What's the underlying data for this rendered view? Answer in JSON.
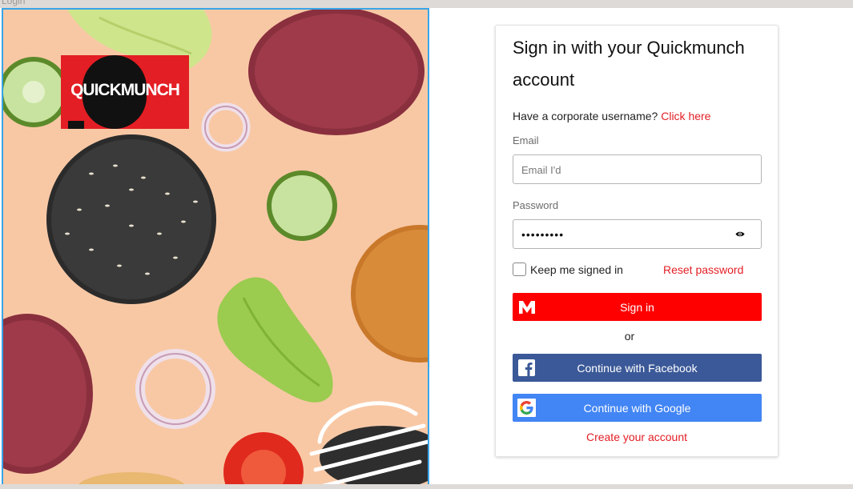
{
  "window": {
    "title": "Login"
  },
  "brand": {
    "logo_text": "QUICKMUNCH",
    "color": "#e31e24"
  },
  "login": {
    "title": "Sign in with your Quickmunch account",
    "corporate_prompt": "Have a corporate username?",
    "corporate_link": "Click here",
    "email_label": "Email",
    "email_placeholder": "Email I'd",
    "email_value": "",
    "password_label": "Password",
    "password_value": "•••••••••",
    "keep_signed_in": "Keep me signed in",
    "keep_signed_in_checked": false,
    "reset_password": "Reset password",
    "sign_in": "Sign in",
    "or": "or",
    "facebook": "Continue with Facebook",
    "google": "Continue with Google",
    "create_account": "Create your account"
  },
  "colors": {
    "accent_red": "#ff0000",
    "facebook": "#3b5998",
    "google": "#4285f4",
    "hero_bg": "#f8c8a5"
  }
}
